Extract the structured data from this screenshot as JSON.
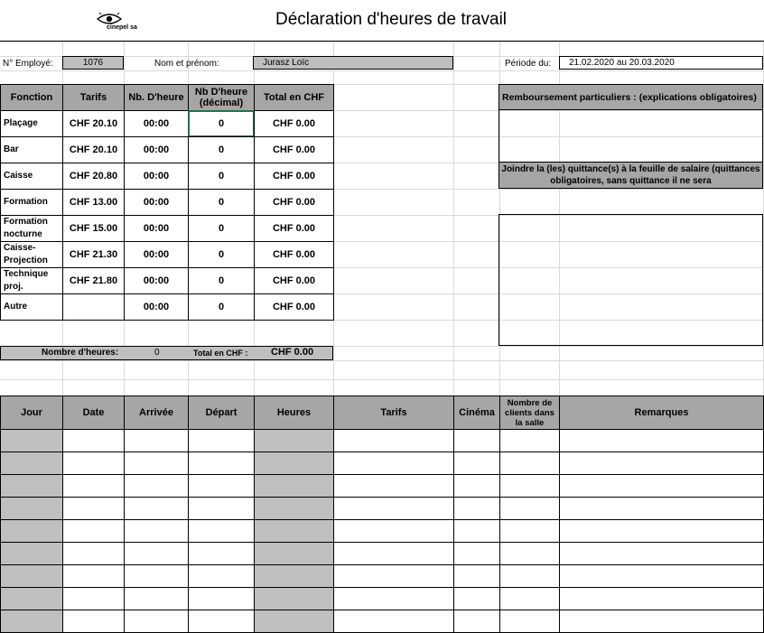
{
  "header": {
    "logo_text": "cinepel sa",
    "title": "Déclaration d'heures de travail"
  },
  "info": {
    "employee_label": "N° Employé:",
    "employee_value": "1076",
    "name_label": "Nom et prénom:",
    "name_value": "Jurasz Loïc",
    "period_label": "Période du:",
    "period_value": "21.02.2020 au 20.03.2020"
  },
  "rates_table": {
    "headers": [
      "Fonction",
      "Tarifs",
      "Nb. D'heure",
      "Nb D'heure (décimal)",
      "Total en CHF"
    ],
    "rows": [
      {
        "fonction": "Plaçage",
        "tarif": "CHF 20.10",
        "heures": "00:00",
        "decimal": "0",
        "total": "CHF 0.00"
      },
      {
        "fonction": "Bar",
        "tarif": "CHF 20.10",
        "heures": "00:00",
        "decimal": "0",
        "total": "CHF 0.00"
      },
      {
        "fonction": "Caisse",
        "tarif": "CHF 20.80",
        "heures": "00:00",
        "decimal": "0",
        "total": "CHF 0.00"
      },
      {
        "fonction": "Formation",
        "tarif": "CHF 13.00",
        "heures": "00:00",
        "decimal": "0",
        "total": "CHF 0.00"
      },
      {
        "fonction": "Formation nocturne",
        "tarif": "CHF 15.00",
        "heures": "00:00",
        "decimal": "0",
        "total": "CHF 0.00"
      },
      {
        "fonction": "Caisse-Projection",
        "tarif": "CHF 21.30",
        "heures": "00:00",
        "decimal": "0",
        "total": "CHF 0.00"
      },
      {
        "fonction": "Technique proj.",
        "tarif": "CHF 21.80",
        "heures": "00:00",
        "decimal": "0",
        "total": "CHF 0.00"
      },
      {
        "fonction": "Autre",
        "tarif": "",
        "heures": "00:00",
        "decimal": "0",
        "total": "CHF 0.00"
      }
    ]
  },
  "summary": {
    "hours_label": "Nombre d'heures:",
    "hours_value": "0",
    "total_label": "Total en CHF :",
    "total_value": "CHF 0.00"
  },
  "reimbursement": {
    "header": "Remboursement particuliers : (explications obligatoires)",
    "receipt_note": "Joindre la (les) quittance(s) à la feuille de salaire (quittances obligatoires, sans quittance il ne sera"
  },
  "daily_table": {
    "headers": [
      "Jour",
      "Date",
      "Arrivée",
      "Départ",
      "Heures",
      "Tarifs",
      "Cinéma",
      "Nombre de clients dans la salle",
      "Remarques"
    ]
  }
}
